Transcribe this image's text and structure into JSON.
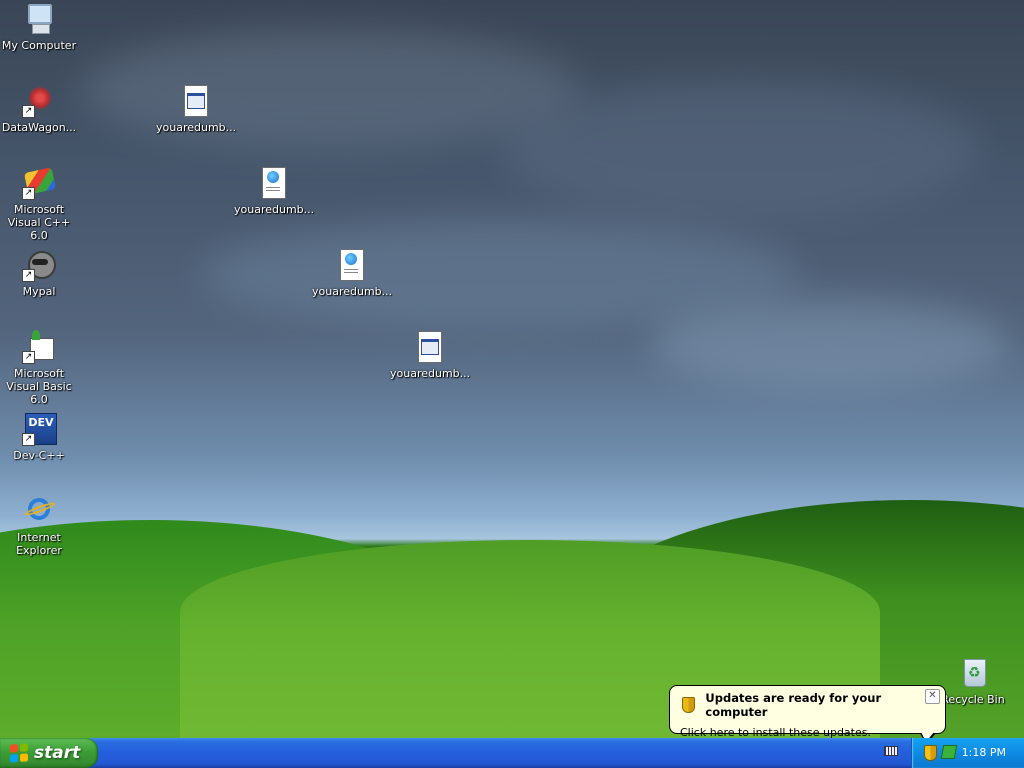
{
  "desktop": {
    "icons": [
      {
        "label": "My Computer",
        "icon": "computer-icon"
      },
      {
        "label": "DataWagon...",
        "icon": "datawagon-icon"
      },
      {
        "label": "Microsoft Visual C++ 6.0",
        "icon": "visual-cpp-icon"
      },
      {
        "label": "Mypal",
        "icon": "mypal-icon"
      },
      {
        "label": "Microsoft Visual Basic 6.0",
        "icon": "visual-basic-icon"
      },
      {
        "label": "Dev-C++",
        "icon": "devcpp-icon"
      },
      {
        "label": "Internet Explorer",
        "icon": "internet-explorer-icon"
      },
      {
        "label": "youaredumb...",
        "icon": "exe-file-icon"
      },
      {
        "label": "youaredumb...",
        "icon": "html-file-icon"
      },
      {
        "label": "youaredumb...",
        "icon": "html-file-icon"
      },
      {
        "label": "youaredumb...",
        "icon": "exe-file-icon"
      },
      {
        "label": "Recycle Bin",
        "icon": "recycle-bin-icon"
      }
    ],
    "devcpp_badge": "DEV"
  },
  "taskbar": {
    "start_label": "start",
    "clock": "1:18 PM"
  },
  "balloon": {
    "title": "Updates are ready for your computer",
    "message": "Click here to install these updates.",
    "close_glyph": "✕"
  },
  "colors": {
    "start_green": "#3d9d37",
    "taskbar_blue": "#245edb",
    "tray_blue": "#0e8ae2",
    "balloon_bg": "#ffffe1"
  }
}
